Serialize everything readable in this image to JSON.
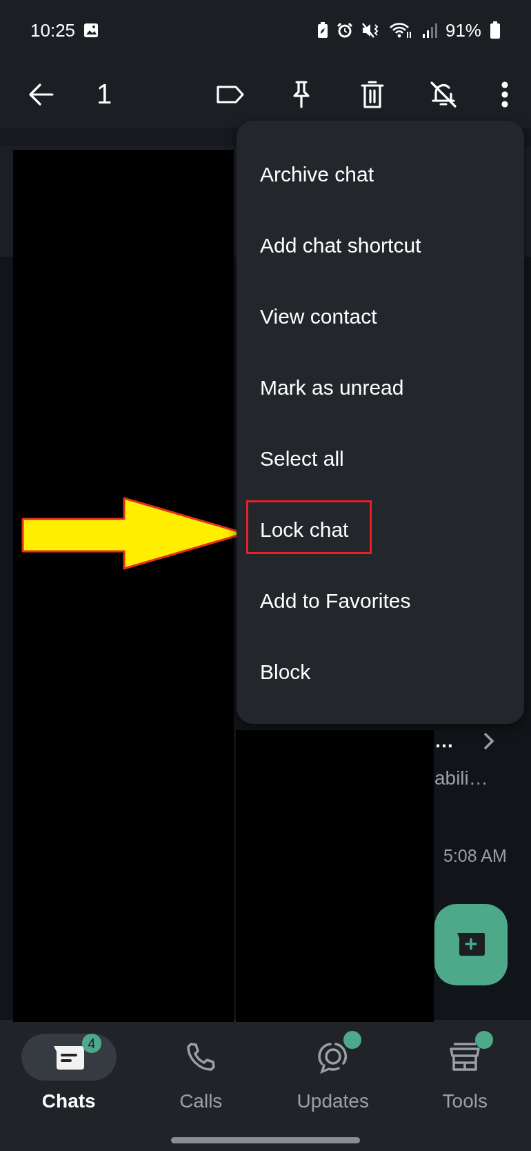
{
  "status_bar": {
    "time": "10:25",
    "battery": "91%"
  },
  "toolbar": {
    "selected_count": "1"
  },
  "menu": {
    "items": [
      {
        "label": "Archive chat",
        "highlighted": false
      },
      {
        "label": "Add chat shortcut",
        "highlighted": false
      },
      {
        "label": "View contact",
        "highlighted": false
      },
      {
        "label": "Mark as unread",
        "highlighted": false
      },
      {
        "label": "Select all",
        "highlighted": false
      },
      {
        "label": "Lock chat",
        "highlighted": true
      },
      {
        "label": "Add to Favorites",
        "highlighted": false
      },
      {
        "label": "Block",
        "highlighted": false
      }
    ]
  },
  "chat_row": {
    "title_end": "…",
    "preview_end": "abili…",
    "time": "5:08 AM"
  },
  "bottom_nav": {
    "tabs": [
      {
        "kind": "chats",
        "label": "Chats",
        "selected": true,
        "badge": "4",
        "has_update": false
      },
      {
        "kind": "calls",
        "label": "Calls",
        "selected": false,
        "has_update": false
      },
      {
        "kind": "updates",
        "label": "Updates",
        "selected": false,
        "has_update": true
      },
      {
        "kind": "tools",
        "label": "Tools",
        "selected": false,
        "has_update": true
      }
    ]
  }
}
